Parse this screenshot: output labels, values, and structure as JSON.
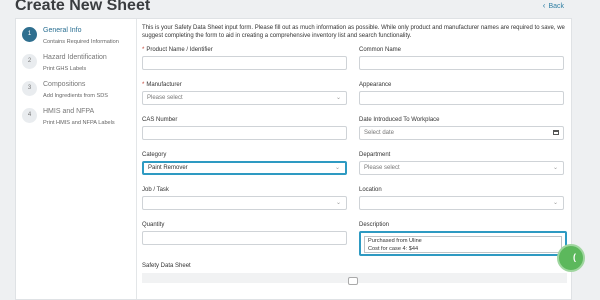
{
  "page": {
    "title": "Create New Sheet",
    "back_label": "Back"
  },
  "steps": [
    {
      "number": "1",
      "title": "General Info",
      "subtitle": "Contains Required Information"
    },
    {
      "number": "2",
      "title": "Hazard Identification",
      "subtitle": "Print GHS Labels"
    },
    {
      "number": "3",
      "title": "Compositions",
      "subtitle": "Add Ingredients from SDS"
    },
    {
      "number": "4",
      "title": "HMIS and NFPA",
      "subtitle": "Print HMIS and NFPA Labels"
    }
  ],
  "form": {
    "intro": "This is your Safety Data Sheet input form. Please fill out as much information as possible. While only product and manufacturer names are required to save, we suggest completing the form to aid in creating a comprehensive inventory list and search functionality.",
    "product_name": {
      "label": "Product Name / Identifier",
      "value": ""
    },
    "common_name": {
      "label": "Common Name",
      "value": ""
    },
    "manufacturer": {
      "label": "Manufacturer",
      "placeholder": "Please select"
    },
    "appearance": {
      "label": "Appearance",
      "value": ""
    },
    "cas_number": {
      "label": "CAS Number",
      "value": ""
    },
    "date_introduced": {
      "label": "Date Introduced To Workplace",
      "placeholder": "Select date"
    },
    "category": {
      "label": "Category",
      "value": "Paint Remover"
    },
    "department": {
      "label": "Department",
      "placeholder": "Please select"
    },
    "job_task": {
      "label": "Job / Task",
      "value": ""
    },
    "location": {
      "label": "Location",
      "value": ""
    },
    "quantity": {
      "label": "Quantity",
      "value": ""
    },
    "description": {
      "label": "Description",
      "line1": "Purchased from Uline",
      "line2": "Cost for case 4: $44"
    },
    "safety_data_sheet": {
      "label": "Safety Data Sheet"
    }
  },
  "colors": {
    "accent": "#2e9ac2",
    "step_active": "#2f6f8f",
    "fab": "#5cb85c"
  },
  "icons": [
    "chevron-left-icon",
    "chevron-down-icon",
    "calendar-icon",
    "chat-icon"
  ]
}
